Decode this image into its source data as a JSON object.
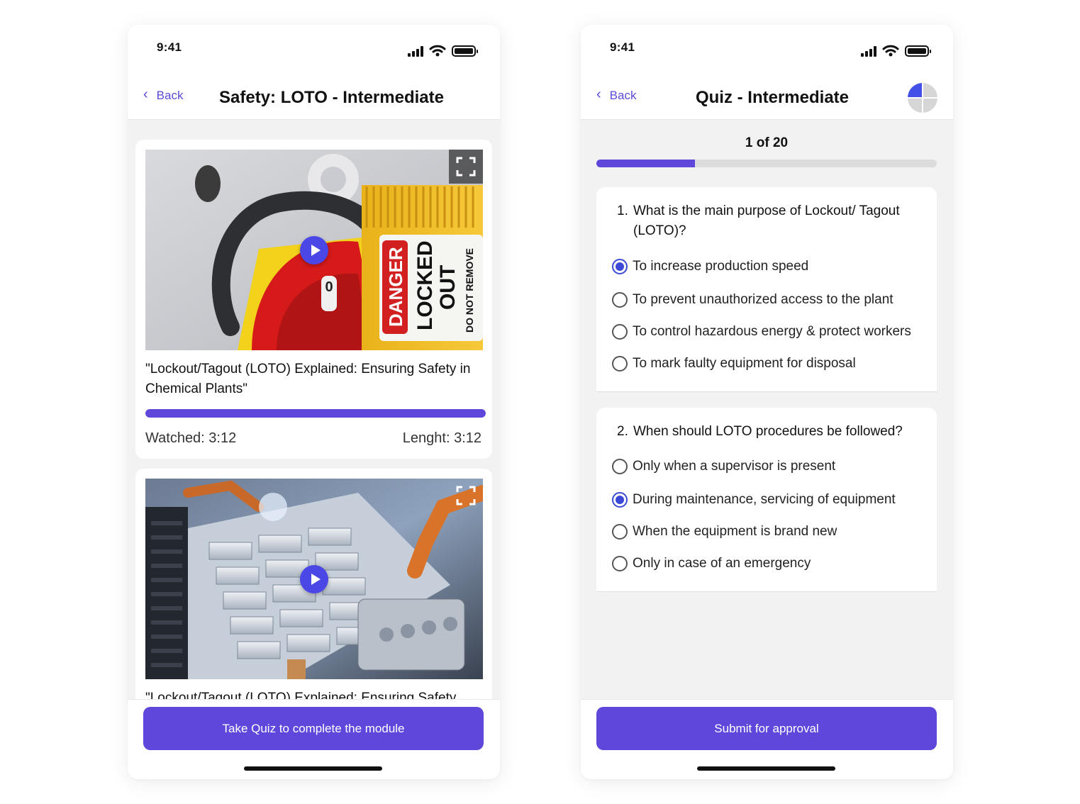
{
  "colors": {
    "accent": "#5f47dc",
    "radio_selected": "#3b49d6",
    "link": "#5a4cd8"
  },
  "left": {
    "status_time": "9:41",
    "back_label": "Back",
    "title": "Safety: LOTO - Intermediate",
    "videos": [
      {
        "title": "\"Lockout/Tagout (LOTO) Explained: Ensuring Safety in Chemical Plants\"",
        "watched": "Watched: 3:12",
        "length": "Lenght: 3:12",
        "progress": 1.0,
        "lock_label_danger": "DANGER",
        "lock_label_locked": "LOCKED",
        "lock_label_out": "OUT",
        "lock_label_remove": "DO NOT REMOVE"
      },
      {
        "title": "\"Lockout/Tagout (LOTO) Explained: Ensuring Safety"
      }
    ],
    "cta_label": "Take Quiz to complete the module"
  },
  "right": {
    "status_time": "9:41",
    "back_label": "Back",
    "title": "Quiz - Intermediate",
    "counter": "1 of 20",
    "progress": 0.29,
    "questions": [
      {
        "number": "1.",
        "text": "What is the main purpose of Lockout/ Tagout (LOTO)?",
        "options": [
          "To increase production speed",
          "To prevent unauthorized access to the plant",
          "To control hazardous energy & protect workers",
          "To mark faulty equipment for disposal"
        ],
        "selected": 0
      },
      {
        "number": "2.",
        "text": "When should LOTO procedures be followed?",
        "options": [
          "Only when a supervisor is present",
          "During maintenance, servicing of equipment",
          "When the equipment is brand new",
          "Only in case of an emergency"
        ],
        "selected": 1
      }
    ],
    "cta_label": "Submit for approval"
  }
}
